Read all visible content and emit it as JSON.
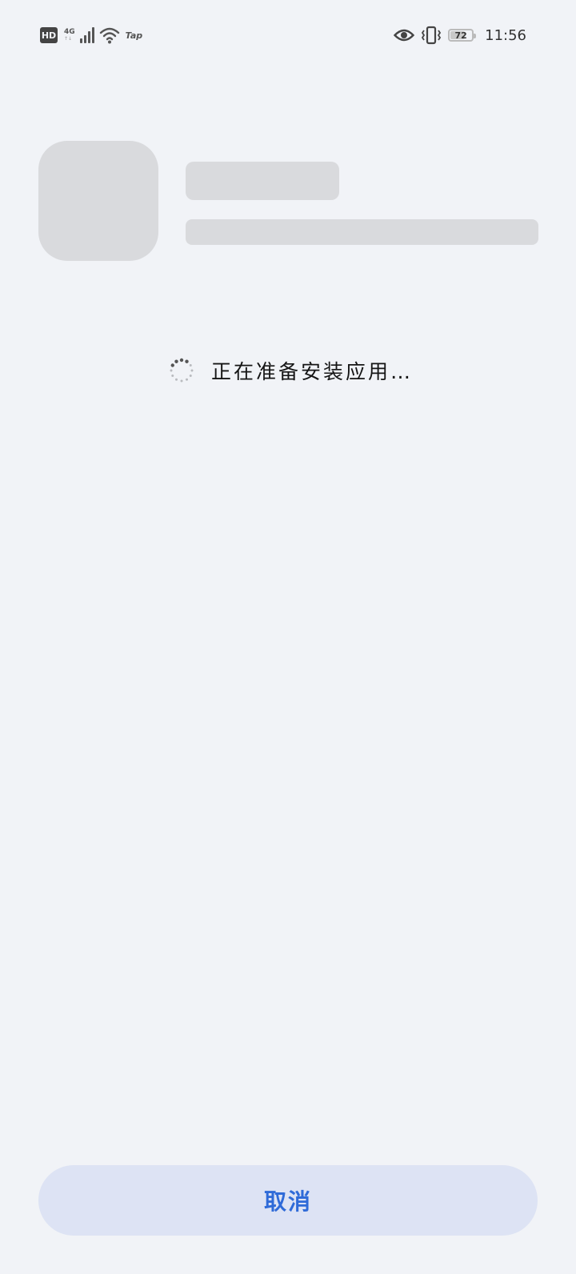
{
  "status_bar": {
    "hd_label": "HD",
    "network_type": "4G",
    "network_sub": "↑↓",
    "signal_bars": 4,
    "wifi_icon": "wifi-icon",
    "extra_label": "Tap",
    "eye_icon": "eye-comfort-icon",
    "vibrate_icon": "vibrate-icon",
    "battery_level": "72",
    "battery_percent": 72,
    "time": "11:56"
  },
  "install": {
    "status_text": "正在准备安装应用…",
    "spinner_icon": "loading-spinner-icon"
  },
  "footer": {
    "cancel_label": "取消"
  },
  "colors": {
    "background": "#f1f3f7",
    "skeleton": "#d9dadd",
    "button_bg": "#dde3f4",
    "accent": "#2f6bd8"
  }
}
